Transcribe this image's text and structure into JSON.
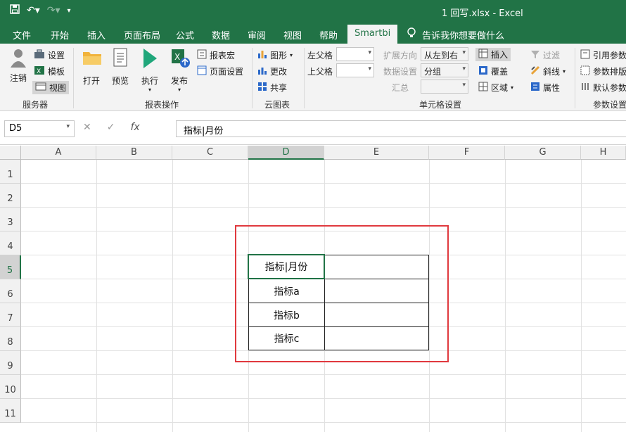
{
  "window": {
    "title": "1 回写.xlsx  -  Excel"
  },
  "tabs": [
    {
      "label": "文件"
    },
    {
      "label": "开始"
    },
    {
      "label": "插入"
    },
    {
      "label": "页面布局"
    },
    {
      "label": "公式"
    },
    {
      "label": "数据"
    },
    {
      "label": "审阅"
    },
    {
      "label": "视图"
    },
    {
      "label": "帮助"
    },
    {
      "label": "Smartbi"
    }
  ],
  "tell_me": "告诉我你想要做什么",
  "ribbon": {
    "server": {
      "label": "服务器",
      "logout": "注销",
      "settings": "设置",
      "template": "模板",
      "view": "视图"
    },
    "report_ops": {
      "label": "报表操作",
      "open": "打开",
      "preview": "预览",
      "execute": "执行",
      "publish": "发布",
      "report_macro": "报表宏",
      "page_setup": "页面设置"
    },
    "cloud": {
      "label": "云图表",
      "chart": "图形",
      "change": "更改",
      "share": "共享"
    },
    "cell": {
      "label": "单元格设置",
      "left_parent": "左父格",
      "top_parent": "上父格",
      "expand_dir": "扩展方向",
      "data_setting": "数据设置",
      "summary": "汇总",
      "expand_value": "从左到右",
      "data_value": "分组"
    },
    "insert": {
      "insert": "插入",
      "cover": "覆盖",
      "region": "区域",
      "filter": "过滤",
      "diagonal": "斜线",
      "property": "属性"
    },
    "params": {
      "label": "参数设置",
      "ref_params": "引用参数",
      "param_layout": "参数排版",
      "default_params": "默认参数"
    }
  },
  "formula_bar": {
    "name_box": "D5",
    "formula": "指标|月份"
  },
  "columns": [
    "A",
    "B",
    "C",
    "D",
    "E",
    "F",
    "G",
    "H"
  ],
  "rows": [
    "1",
    "2",
    "3",
    "4",
    "5",
    "6",
    "7",
    "8",
    "9",
    "10",
    "11"
  ],
  "table": {
    "header": "指标|月份",
    "rows": [
      "指标a",
      "指标b",
      "指标c"
    ]
  },
  "colors": {
    "excel_green": "#217346",
    "highlight_red": "#e0393e"
  }
}
